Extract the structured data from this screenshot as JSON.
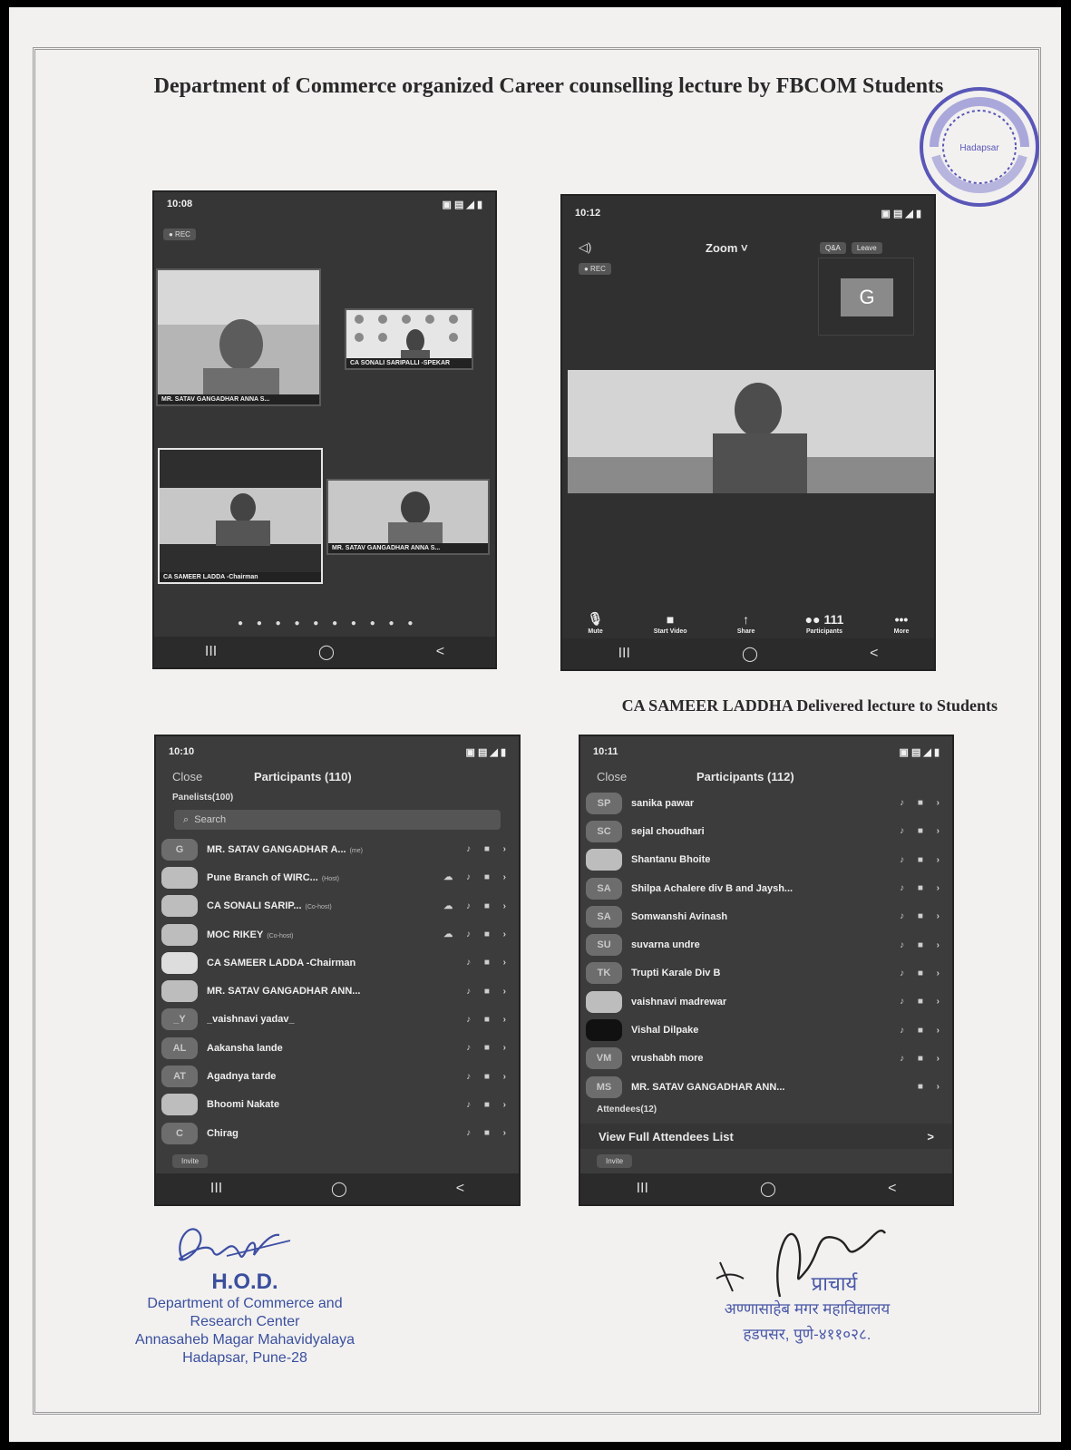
{
  "document": {
    "title": "Department of Commerce organized Career counselling lecture by FBCOM Students",
    "caption": "CA SAMEER LADDHA Delivered lecture to Students"
  },
  "stamp": {
    "text": "Annasaheb Magar Mahavidyalaya Hadapsar"
  },
  "phone1": {
    "time": "10:08",
    "rec": "● REC",
    "tiles": [
      {
        "label": "MR. SATAV GANGADHAR ANNA S..."
      },
      {
        "label": "CA SONALI SARIPALLI -SPEKAR"
      },
      {
        "label": "CA SAMEER LADDA -Chairman"
      },
      {
        "label": "MR. SATAV GANGADHAR ANNA S..."
      }
    ],
    "nav": [
      "III",
      "◯",
      "<"
    ]
  },
  "phone2": {
    "time": "10:12",
    "rec": "● REC",
    "zoom_label": "Zoom ˅",
    "qa": "Q&A",
    "leave": "Leave",
    "g_initial": "G",
    "toolbar": [
      {
        "icon": "🎙",
        "label": "Mute"
      },
      {
        "icon": "■",
        "label": "Start Video"
      },
      {
        "icon": "↑",
        "label": "Share"
      },
      {
        "icon": "●● 111",
        "label": "Participants"
      },
      {
        "icon": "•••",
        "label": "More"
      }
    ],
    "nav": [
      "III",
      "◯",
      "<"
    ]
  },
  "phone3": {
    "time": "10:10",
    "close": "Close",
    "title": "Participants (110)",
    "section": "Panelists(100)",
    "search_placeholder": "Search",
    "rows": [
      {
        "av": "G",
        "name": "MR. SATAV GANGADHAR A...",
        "tag": "(me)"
      },
      {
        "av": "",
        "name": "Pune Branch of WIRC...",
        "tag": "(Host)"
      },
      {
        "av": "",
        "name": "CA SONALI SARIP...",
        "tag": "(Co-host)"
      },
      {
        "av": "",
        "name": "MOC RIKEY",
        "tag": "(Co-host)"
      },
      {
        "av": "",
        "name": "CA SAMEER LADDA -Chairman",
        "tag": ""
      },
      {
        "av": "",
        "name": "MR. SATAV GANGADHAR ANN...",
        "tag": ""
      },
      {
        "av": "_Y",
        "name": "_vaishnavi yadav_",
        "tag": ""
      },
      {
        "av": "AL",
        "name": "Aakansha lande",
        "tag": ""
      },
      {
        "av": "AT",
        "name": "Agadnya tarde",
        "tag": ""
      },
      {
        "av": "",
        "name": "Bhoomi Nakate",
        "tag": ""
      },
      {
        "av": "C",
        "name": "Chirag",
        "tag": ""
      }
    ],
    "invite": "Invite",
    "nav": [
      "III",
      "◯",
      "<"
    ]
  },
  "phone4": {
    "time": "10:11",
    "close": "Close",
    "title": "Participants (112)",
    "rows": [
      {
        "av": "SP",
        "name": "sanika pawar"
      },
      {
        "av": "SC",
        "name": "sejal choudhari"
      },
      {
        "av": "",
        "name": "Shantanu Bhoite"
      },
      {
        "av": "SA",
        "name": "Shilpa Achalere div B and Jaysh..."
      },
      {
        "av": "SA",
        "name": "Somwanshi Avinash"
      },
      {
        "av": "SU",
        "name": "suvarna undre"
      },
      {
        "av": "TK",
        "name": "Trupti Karale Div B"
      },
      {
        "av": "",
        "name": "vaishnavi madrewar"
      },
      {
        "av": "",
        "name": "Vishal Dilpake"
      },
      {
        "av": "VM",
        "name": "vrushabh more"
      },
      {
        "av": "MS",
        "name": "MR. SATAV GANGADHAR ANN..."
      }
    ],
    "attendees": "Attendees(12)",
    "view_full": "View Full Attendees List",
    "chevron": ">",
    "invite": "Invite",
    "nav": [
      "III",
      "◯",
      "<"
    ]
  },
  "hod": {
    "title": "H.O.D.",
    "line1": "Department of Commerce and",
    "line2": "Research Center",
    "line3": "Annasaheb Magar Mahavidyalaya",
    "line4": "Hadapsar, Pune-28"
  },
  "principal": {
    "title": "प्राचार्य",
    "line1": "अण्णासाहेब मगर महाविद्यालय",
    "line2": "हडपसर, पुणे-४११०२८."
  }
}
